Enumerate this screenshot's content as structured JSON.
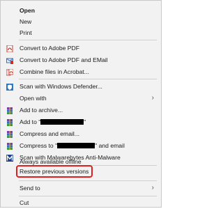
{
  "menu": {
    "items": [
      {
        "label": "Open",
        "bold": true
      },
      {
        "label": "New"
      },
      {
        "label": "Print"
      },
      {
        "label": "Convert to Adobe PDF",
        "icon": "adobe-pdf-icon"
      },
      {
        "label": "Convert to Adobe PDF and EMail",
        "icon": "adobe-pdf-email-icon"
      },
      {
        "label": "Combine files in Acrobat...",
        "icon": "acrobat-combine-icon"
      },
      {
        "label": "Scan with Windows Defender...",
        "icon": "windows-defender-icon"
      },
      {
        "label": "Open with",
        "has_submenu": true
      },
      {
        "label": "Add to archive...",
        "icon": "winrar-icon"
      },
      {
        "prefix": "Add to \"",
        "suffix": "\"",
        "icon": "winrar-icon"
      },
      {
        "label": "Compress and email...",
        "icon": "winrar-icon"
      },
      {
        "prefix": "Compress to \"",
        "suffix": "\" and email",
        "icon": "winrar-icon"
      },
      {
        "label": "Scan with Malwarebytes Anti-Malware",
        "icon": "malwarebytes-icon"
      },
      {
        "label": "Always available offline"
      },
      {
        "label": "Restore previous versions",
        "highlighted": true
      },
      {
        "label": "Send to",
        "has_submenu": true
      },
      {
        "label": "Cut"
      }
    ],
    "highlight_color": "#e01e1e",
    "submenu_glyph": "›"
  }
}
